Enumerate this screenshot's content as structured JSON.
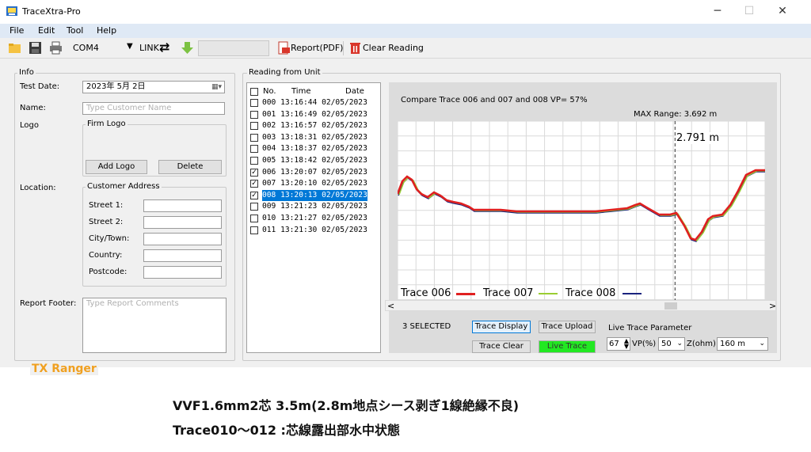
{
  "window": {
    "title": "TraceXtra-Pro",
    "minimize": "─",
    "maximize": "☐",
    "close": "✕"
  },
  "menu": [
    "File",
    "Edit",
    "Tool",
    "Help"
  ],
  "toolbar": {
    "port": "COM4",
    "link_label": "LINK",
    "report_label": "Report(PDF)",
    "clear_label": "Clear Reading"
  },
  "info": {
    "group_title": "Info",
    "test_date_label": "Test Date:",
    "test_date_value": "2023年 5月 2日",
    "name_label": "Name:",
    "name_placeholder": "Type Customer Name",
    "logo_label": "Logo",
    "firm_logo_title": "Firm Logo",
    "add_logo": "Add Logo",
    "delete": "Delete",
    "location_label": "Location:",
    "customer_address_title": "Customer Address",
    "street1": "Street 1:",
    "street2": "Street 2:",
    "city": "City/Town:",
    "country": "Country:",
    "postcode": "Postcode:",
    "report_footer_label": "Report Footer:",
    "report_footer_placeholder": "Type Report Comments"
  },
  "reading": {
    "group_title": "Reading from Unit",
    "col_no": "No.",
    "col_time": "Time",
    "col_date": "Date",
    "rows": [
      {
        "no": "000",
        "time": "13:16:44",
        "date": "02/05/2023",
        "checked": false,
        "selected": false
      },
      {
        "no": "001",
        "time": "13:16:49",
        "date": "02/05/2023",
        "checked": false,
        "selected": false
      },
      {
        "no": "002",
        "time": "13:16:57",
        "date": "02/05/2023",
        "checked": false,
        "selected": false
      },
      {
        "no": "003",
        "time": "13:18:31",
        "date": "02/05/2023",
        "checked": false,
        "selected": false
      },
      {
        "no": "004",
        "time": "13:18:37",
        "date": "02/05/2023",
        "checked": false,
        "selected": false
      },
      {
        "no": "005",
        "time": "13:18:42",
        "date": "02/05/2023",
        "checked": false,
        "selected": false
      },
      {
        "no": "006",
        "time": "13:20:07",
        "date": "02/05/2023",
        "checked": true,
        "selected": false
      },
      {
        "no": "007",
        "time": "13:20:10",
        "date": "02/05/2023",
        "checked": true,
        "selected": false
      },
      {
        "no": "008",
        "time": "13:20:13",
        "date": "02/05/2023",
        "checked": true,
        "selected": true
      },
      {
        "no": "009",
        "time": "13:21:23",
        "date": "02/05/2023",
        "checked": false,
        "selected": false
      },
      {
        "no": "010",
        "time": "13:21:27",
        "date": "02/05/2023",
        "checked": false,
        "selected": false
      },
      {
        "no": "011",
        "time": "13:21:30",
        "date": "02/05/2023",
        "checked": false,
        "selected": false
      }
    ]
  },
  "chart": {
    "compare_text": "Compare Trace 006 and 007 and 008",
    "vp_text": "VP= 57%",
    "max_range": "MAX Range: 3.692 m",
    "cursor_label": "2.791 m",
    "cursor_position": 0.755,
    "legend": [
      {
        "name": "Trace 006",
        "color": "#e02020"
      },
      {
        "name": "Trace 007",
        "color": "#9acd32"
      },
      {
        "name": "Trace 008",
        "color": "#1a237e"
      }
    ],
    "scroll_left": "<",
    "scroll_right": ">"
  },
  "controls": {
    "selected_count": "3 SELECTED",
    "trace_display": "Trace Display",
    "trace_upload": "Trace Upload",
    "trace_clear": "Trace Clear",
    "live_trace": "Live Trace",
    "live_param_label": "Live Trace Parameter",
    "vp_value": "67",
    "vp_unit": "VP(%)",
    "z_value": "50",
    "z_unit": "Z(ohm)",
    "range_value": "160 m"
  },
  "branding": {
    "product": "TX Ranger",
    "product_color": "#f0a020"
  },
  "notes": {
    "line1": "VVF1.6mm2芯  3.5m(2.8m地点シース剥ぎ1線絶縁不良)",
    "line2": "Trace010～012 :芯線露出部水中状態"
  }
}
